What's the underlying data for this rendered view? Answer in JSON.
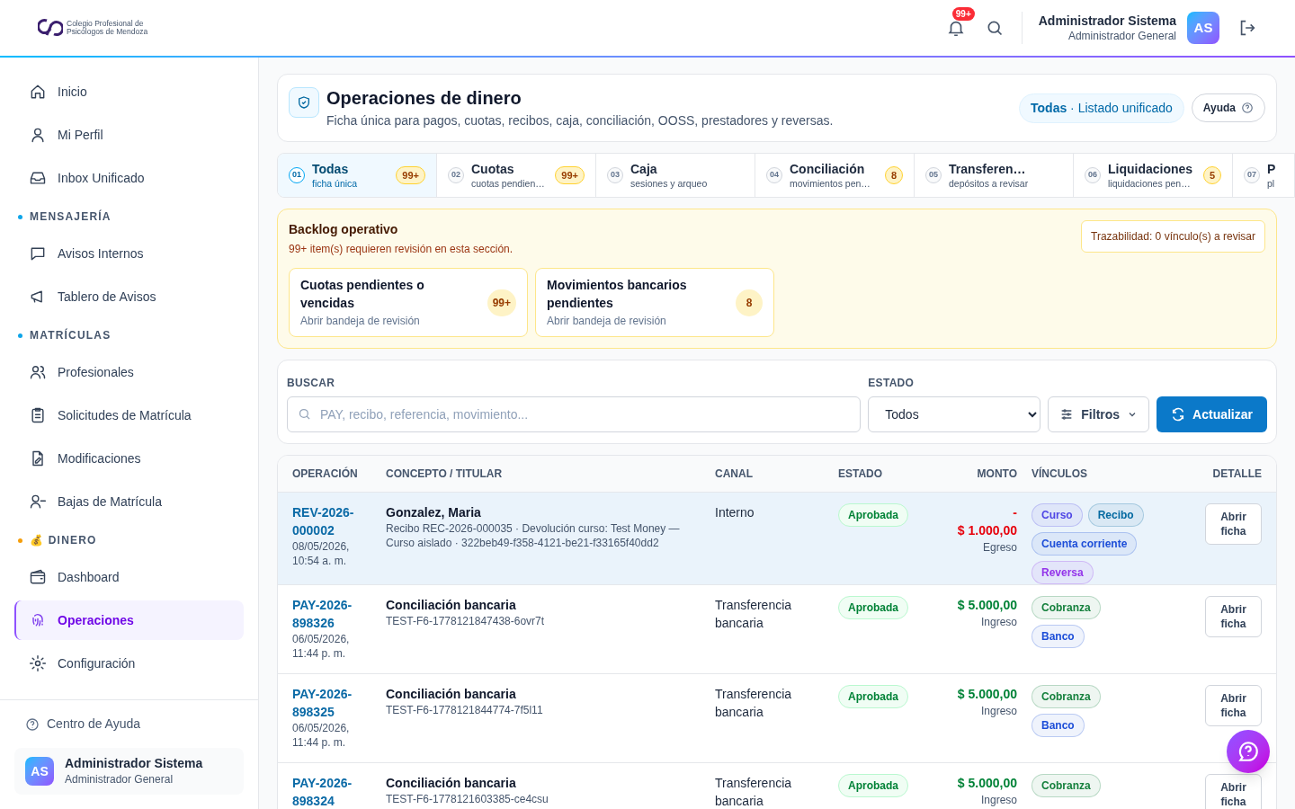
{
  "header": {
    "logo_lines": [
      "Colegio Profesional de",
      "Psicólogos de Mendoza"
    ],
    "notification_count": "99+",
    "user_name": "Administrador Sistema",
    "user_role": "Administrador General",
    "avatar": "AS"
  },
  "sidebar": {
    "sections": [
      {
        "items": [
          {
            "label": "Inicio",
            "selected": false
          },
          {
            "label": "Mi Perfil",
            "selected": false
          },
          {
            "label": "Inbox Unificado",
            "selected": false
          }
        ]
      },
      {
        "title": "MENSAJERÍA",
        "color": "#0ea5e9",
        "items": [
          {
            "label": "Avisos Internos",
            "selected": false
          },
          {
            "label": "Tablero de Avisos",
            "selected": false
          }
        ]
      },
      {
        "title": "MATRÍCULAS",
        "color": "#0ea5e9",
        "items": [
          {
            "label": "Profesionales",
            "selected": false
          },
          {
            "label": "Solicitudes de Matrícula",
            "selected": false
          },
          {
            "label": "Modificaciones",
            "selected": false
          },
          {
            "label": "Bajas de Matrícula",
            "selected": false
          }
        ]
      },
      {
        "title": "💰 DINERO",
        "color": "#f59e0b",
        "items": [
          {
            "label": "Dashboard",
            "selected": false
          },
          {
            "label": "Operaciones",
            "selected": true
          },
          {
            "label": "Configuración",
            "selected": false
          }
        ]
      }
    ],
    "help": "Centro de Ayuda",
    "user_name": "Administrador Sistema",
    "user_role": "Administrador General",
    "avatar": "AS"
  },
  "page": {
    "title": "Operaciones de dinero",
    "subtitle": "Ficha única para pagos, cuotas, recibos, caja, conciliación, OOSS, prestadores y reversas.",
    "scope_bold": "Todas",
    "scope_rest": "· Listado unificado",
    "help_button": "Ayuda"
  },
  "tabs": [
    {
      "number": "01",
      "label": "Todas",
      "sub": "ficha única",
      "count": "99+",
      "selected": true
    },
    {
      "number": "02",
      "label": "Cuotas",
      "sub": "cuotas pendien…",
      "count": "99+",
      "selected": false
    },
    {
      "number": "03",
      "label": "Caja",
      "sub": "sesiones y arqueo",
      "selected": false
    },
    {
      "number": "04",
      "label": "Conciliación",
      "sub": "movimientos pen…",
      "count": "8",
      "selected": false
    },
    {
      "number": "05",
      "label": "Transferen…",
      "sub": "depósitos a revisar",
      "selected": false
    },
    {
      "number": "06",
      "label": "Liquidaciones",
      "sub": "liquidaciones pen…",
      "count": "5",
      "selected": false
    },
    {
      "number": "07",
      "label": "P",
      "sub": "pl",
      "selected": false
    }
  ],
  "backlog": {
    "title": "Backlog operativo",
    "message": "99+ item(s) requieren revisión en esta sección.",
    "traceability": "Trazabilidad: 0 vínculo(s) a revisar",
    "cards": [
      {
        "title": "Cuotas pendientes o vencidas",
        "action": "Abrir bandeja de revisión",
        "count": "99+"
      },
      {
        "title": "Movimientos bancarios pendientes",
        "action": "Abrir bandeja de revisión",
        "count": "8"
      }
    ]
  },
  "filters": {
    "search_label": "BUSCAR",
    "search_placeholder": "PAY, recibo, referencia, movimiento...",
    "status_label": "ESTADO",
    "status_value": "Todos",
    "filters_button": "Filtros",
    "refresh_button": "Actualizar"
  },
  "table": {
    "columns": [
      "OPERACIÓN",
      "CONCEPTO / TITULAR",
      "CANAL",
      "ESTADO",
      "MONTO",
      "VÍNCULOS",
      "DETALLE"
    ],
    "rows": [
      {
        "operation": "REV-2026-000002",
        "date": "08/05/2026, 10:54 a. m.",
        "concept": "Gonzalez, Maria",
        "detail": "Recibo REC-2026-000035 · Devolución curso: Test Money — Curso aislado · 322beb49-f358-4121-be21-f33165f40dd2",
        "channel": "Interno",
        "status": "Aprobada",
        "sign": "-",
        "amount": "$ 1.000,00",
        "kind": "egreso",
        "flow": "Egreso",
        "links": [
          {
            "label": "Curso",
            "color": "#4f46e5"
          },
          {
            "label": "Recibo",
            "color": "#0369a1"
          },
          {
            "label": "Cuenta corriente",
            "color": "#1d4ed8"
          },
          {
            "label": "Reversa",
            "color": "#9333ea"
          }
        ],
        "action": "Abrir ficha",
        "selected": true
      },
      {
        "operation": "PAY-2026-898326",
        "date": "06/05/2026, 11:44 p. m.",
        "concept": "Conciliación bancaria",
        "detail": "TEST-F6-1778121847438-6ovr7t",
        "channel": "Transferencia bancaria",
        "status": "Aprobada",
        "amount": "$ 5.000,00",
        "kind": "ingreso",
        "flow": "Ingreso",
        "links": [
          {
            "label": "Cobranza",
            "color": "#15803d"
          },
          {
            "label": "Banco",
            "color": "#1d4ed8"
          }
        ],
        "action": "Abrir ficha",
        "selected": false
      },
      {
        "operation": "PAY-2026-898325",
        "date": "06/05/2026, 11:44 p. m.",
        "concept": "Conciliación bancaria",
        "detail": "TEST-F6-1778121844774-7f5l11",
        "channel": "Transferencia bancaria",
        "status": "Aprobada",
        "amount": "$ 5.000,00",
        "kind": "ingreso",
        "flow": "Ingreso",
        "links": [
          {
            "label": "Cobranza",
            "color": "#15803d"
          },
          {
            "label": "Banco",
            "color": "#1d4ed8"
          }
        ],
        "action": "Abrir ficha",
        "selected": false
      },
      {
        "operation": "PAY-2026-898324",
        "concept": "Conciliación bancaria",
        "detail": "TEST-F6-1778121603385-ce4csu",
        "channel": "Transferencia bancaria",
        "status": "Aprobada",
        "amount": "$ 5.000,00",
        "kind": "ingreso",
        "flow": "Ingreso",
        "links": [
          {
            "label": "Cobranza",
            "color": "#15803d"
          }
        ],
        "action": "Abrir ficha",
        "selected": false
      }
    ]
  }
}
